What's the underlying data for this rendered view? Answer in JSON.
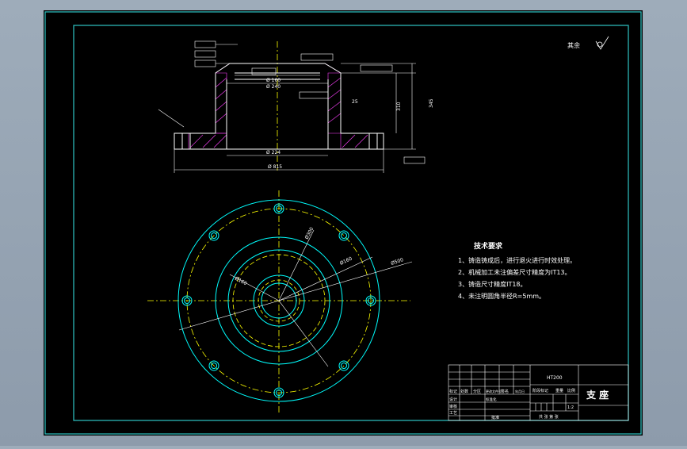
{
  "drawing": {
    "title": "支 座",
    "scale": "1:2",
    "roughness_note": "其余",
    "tech_requirements": {
      "heading": "技术要求",
      "items": [
        "1、铸造铸成后，进行退火进行时效处理。",
        "2、机械加工未注偏差尺寸精度为IT13。",
        "3、铸造尺寸精度IT18。",
        "4、未注明圆角半径R=5mm。"
      ]
    },
    "section_dims": {
      "d_top": "Ø 160",
      "d_mid": "Ø 240",
      "d_bore": "Ø 224",
      "d_flange": "Ø 815",
      "h_inner": "310",
      "h_total": "345",
      "wall": "25"
    },
    "plan_dims": {
      "d1": "Ø300",
      "d2": "Ø160",
      "d3": "Ø160",
      "d4": "Ø500"
    },
    "title_block": {
      "material": "HT200",
      "row_labels": [
        "标记",
        "处数",
        "分区",
        "更改文件号",
        "签名",
        "年月日"
      ],
      "designer_label": "设计",
      "standard_label": "标准化",
      "review_label": "审核",
      "process_label": "工艺",
      "approve_label": "批准",
      "stage_label": "阶段标记",
      "weight_label": "重量",
      "scale_label": "比例",
      "sheet_label": "共 张 第 张"
    }
  },
  "colors": {
    "border": "#2ec4c4",
    "geometry": "#ffffff",
    "center": "#ffff00",
    "section": "#00ffff",
    "hatch": "#ff40ff"
  }
}
